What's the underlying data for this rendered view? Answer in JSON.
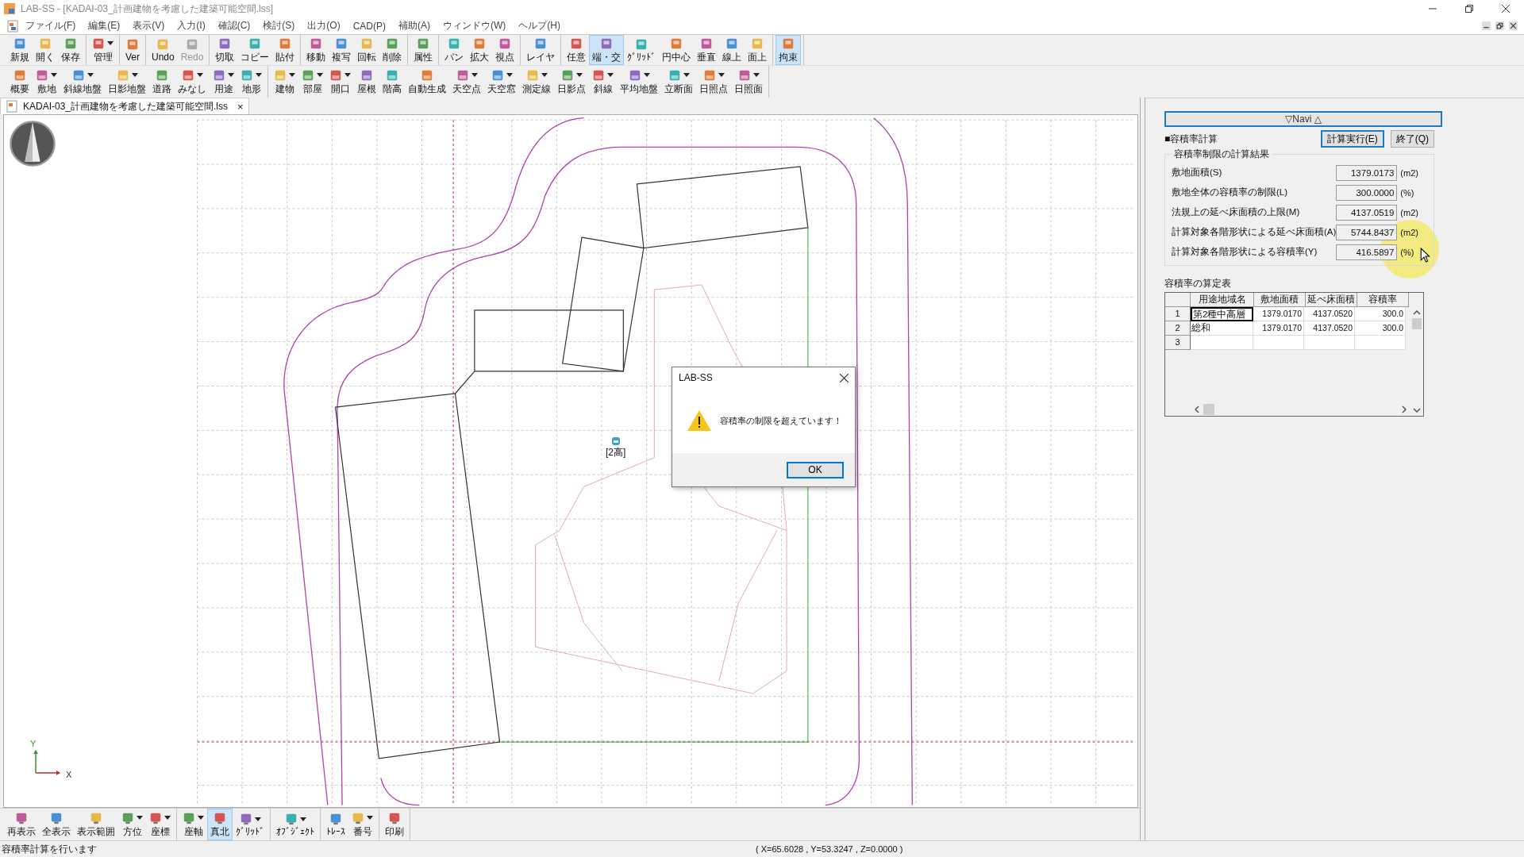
{
  "window": {
    "title": "LAB-SS - [KADAI-03_計画建物を考慮した建築可能空間.lss]"
  },
  "menu": [
    "ファイル(F)",
    "編集(E)",
    "表示(V)",
    "入力(I)",
    "確認(C)",
    "検討(S)",
    "出力(O)",
    "CAD(P)",
    "補助(A)",
    "ウィンドウ(W)",
    "ヘルプ(H)"
  ],
  "toolbar_main": [
    [
      {
        "label": "新規",
        "dropdown": false,
        "pressed": false,
        "disabled": false
      },
      {
        "label": "開く",
        "dropdown": false,
        "pressed": false,
        "disabled": false
      },
      {
        "label": "保存",
        "dropdown": false,
        "pressed": false,
        "disabled": false
      }
    ],
    [
      {
        "label": "管理",
        "dropdown": true,
        "pressed": false,
        "disabled": false
      }
    ],
    [
      {
        "label": "Ver",
        "dropdown": false,
        "pressed": false,
        "disabled": false
      }
    ],
    [
      {
        "label": "Undo",
        "dropdown": false,
        "pressed": false,
        "disabled": false
      },
      {
        "label": "Redo",
        "dropdown": false,
        "pressed": false,
        "disabled": true
      }
    ],
    [
      {
        "label": "切取",
        "dropdown": false,
        "pressed": false,
        "disabled": false
      },
      {
        "label": "コピー",
        "dropdown": false,
        "pressed": false,
        "disabled": false
      },
      {
        "label": "貼付",
        "dropdown": false,
        "pressed": false,
        "disabled": false
      }
    ],
    [
      {
        "label": "移動",
        "dropdown": false,
        "pressed": false,
        "disabled": false
      },
      {
        "label": "複写",
        "dropdown": false,
        "pressed": false,
        "disabled": false
      },
      {
        "label": "回転",
        "dropdown": false,
        "pressed": false,
        "disabled": false
      },
      {
        "label": "削除",
        "dropdown": false,
        "pressed": false,
        "disabled": false
      }
    ],
    [
      {
        "label": "属性",
        "dropdown": false,
        "pressed": false,
        "disabled": false
      }
    ],
    [
      {
        "label": "パン",
        "dropdown": false,
        "pressed": false,
        "disabled": false
      },
      {
        "label": "拡大",
        "dropdown": false,
        "pressed": false,
        "disabled": false
      },
      {
        "label": "視点",
        "dropdown": false,
        "pressed": false,
        "disabled": false
      }
    ],
    [
      {
        "label": "レイヤ",
        "dropdown": false,
        "pressed": false,
        "disabled": false
      }
    ],
    [
      {
        "label": "任意",
        "dropdown": false,
        "pressed": false,
        "disabled": false
      },
      {
        "label": "端・交",
        "dropdown": false,
        "pressed": true,
        "disabled": false
      },
      {
        "label": "ｸﾞﾘｯﾄﾞ",
        "dropdown": false,
        "pressed": false,
        "disabled": false
      },
      {
        "label": "円中心",
        "dropdown": false,
        "pressed": false,
        "disabled": false
      },
      {
        "label": "垂直",
        "dropdown": false,
        "pressed": false,
        "disabled": false
      },
      {
        "label": "線上",
        "dropdown": false,
        "pressed": false,
        "disabled": false
      },
      {
        "label": "面上",
        "dropdown": false,
        "pressed": false,
        "disabled": false
      }
    ],
    [
      {
        "label": "拘束",
        "dropdown": false,
        "pressed": true,
        "disabled": false
      }
    ]
  ],
  "toolbar_input": [
    [
      {
        "label": "概要",
        "dropdown": false
      },
      {
        "label": "敷地",
        "dropdown": true
      },
      {
        "label": "斜線地盤",
        "dropdown": true
      },
      {
        "label": "日影地盤",
        "dropdown": true
      },
      {
        "label": "道路",
        "dropdown": false
      },
      {
        "label": "みなし",
        "dropdown": true
      },
      {
        "label": "用途",
        "dropdown": true
      },
      {
        "label": "地形",
        "dropdown": true
      }
    ],
    [
      {
        "label": "建物",
        "dropdown": true
      },
      {
        "label": "部屋",
        "dropdown": true
      },
      {
        "label": "開口",
        "dropdown": true
      },
      {
        "label": "屋根",
        "dropdown": false
      },
      {
        "label": "階高",
        "dropdown": false
      },
      {
        "label": "自動生成",
        "dropdown": false
      },
      {
        "label": "天空点",
        "dropdown": true
      },
      {
        "label": "天空窓",
        "dropdown": true
      },
      {
        "label": "測定線",
        "dropdown": true
      },
      {
        "label": "日影点",
        "dropdown": true
      },
      {
        "label": "斜線",
        "dropdown": true
      },
      {
        "label": "平均地盤",
        "dropdown": true
      },
      {
        "label": "立断面",
        "dropdown": true
      },
      {
        "label": "日照点",
        "dropdown": true
      },
      {
        "label": "日照面",
        "dropdown": true
      }
    ]
  ],
  "document_tab": {
    "title": "KADAI-03_計画建物を考慮した建築可能空間.lss",
    "close": "×"
  },
  "canvas": {
    "point_label": "[2高]",
    "axis_x": "X",
    "axis_y": "Y"
  },
  "dialog": {
    "title": "LAB-SS",
    "message": "容積率の制限を超えています！",
    "button": "OK"
  },
  "toolbar_view": [
    [
      {
        "label": "再表示",
        "dropdown": false,
        "pressed": false
      },
      {
        "label": "全表示",
        "dropdown": false,
        "pressed": false
      },
      {
        "label": "表示範囲",
        "dropdown": false,
        "pressed": false
      },
      {
        "label": "方位",
        "dropdown": true,
        "pressed": false
      },
      {
        "label": "座標",
        "dropdown": true,
        "pressed": false
      }
    ],
    [
      {
        "label": "座軸",
        "dropdown": true,
        "pressed": false
      },
      {
        "label": "真北",
        "dropdown": false,
        "pressed": true
      },
      {
        "label": "ｸﾞﾘｯﾄﾞ",
        "dropdown": true,
        "pressed": false
      }
    ],
    [
      {
        "label": "ｵﾌﾞｼﾞｪｸﾄ",
        "dropdown": true,
        "pressed": false
      }
    ],
    [
      {
        "label": "ﾄﾚｰｽ",
        "dropdown": false,
        "pressed": false
      },
      {
        "label": "番号",
        "dropdown": true,
        "pressed": false
      }
    ],
    [
      {
        "label": "印刷",
        "dropdown": false,
        "pressed": false
      }
    ]
  ],
  "navi": {
    "header": "▽Navi △",
    "section": "■容積率計算",
    "buttons": [
      {
        "label": "計算実行(E)",
        "default": true
      },
      {
        "label": "終了(Q)",
        "default": false
      }
    ],
    "results_title": "容積率制限の計算結果",
    "results": [
      {
        "label": "敷地面積(S)",
        "value": "1379.0173",
        "unit": "(m2)"
      },
      {
        "label": "敷地全体の容積率の制限(L)",
        "value": "300.0000",
        "unit": "(%)"
      },
      {
        "label": "法規上の延べ床面積の上限(M)",
        "value": "4137.0519",
        "unit": "(m2)"
      },
      {
        "label": "計算対象各階形状による延べ床面積(A)",
        "value": "5744.8437",
        "unit": "(m2)"
      },
      {
        "label": "計算対象各階形状による容積率(Y)",
        "value": "416.5897",
        "unit": "(%)"
      }
    ],
    "table": {
      "title": "容積率の算定表",
      "columns": [
        "用途地域名",
        "敷地面積",
        "延べ床面積",
        "容積率"
      ],
      "rows": [
        {
          "index": "1",
          "selected": true,
          "cells": [
            "第2種中高層",
            "1379.0170",
            "4137.0520",
            "300.0"
          ]
        },
        {
          "index": "2",
          "selected": false,
          "cells": [
            "総和",
            "1379.0170",
            "4137.0520",
            "300.0"
          ]
        },
        {
          "index": "3",
          "selected": false
        }
      ]
    }
  },
  "status_bar": {
    "message": "容積率計算を行います",
    "coordinates": "( X=65.6028 , Y=53.3247 , Z=0.0000 )"
  }
}
